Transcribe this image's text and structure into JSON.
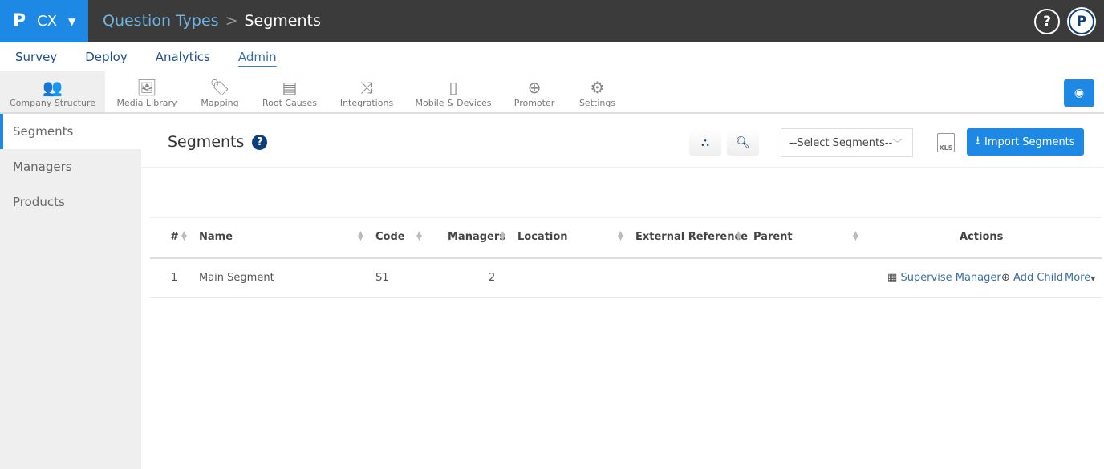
{
  "header": {
    "logo": "P",
    "product": "CX",
    "breadcrumb": [
      "Question Types",
      "Segments"
    ],
    "help_icon": "?",
    "profile_icon": "P"
  },
  "nav": [
    "Survey",
    "Deploy",
    "Analytics",
    "Admin"
  ],
  "tools": [
    {
      "label": "Company Structure",
      "icon": "people-icon"
    },
    {
      "label": "Media Library",
      "icon": "image-icon"
    },
    {
      "label": "Mapping",
      "icon": "tag-icon"
    },
    {
      "label": "Root Causes",
      "icon": "root-causes-icon"
    },
    {
      "label": "Integrations",
      "icon": "shuffle-icon"
    },
    {
      "label": "Mobile & Devices",
      "icon": "mobile-icon"
    },
    {
      "label": "Promoter",
      "icon": "chat-plus-icon"
    },
    {
      "label": "Settings",
      "icon": "gear-icon"
    }
  ],
  "sidebar": [
    "Segments",
    "Managers",
    "Products"
  ],
  "page": {
    "title": "Segments",
    "select_placeholder": "--Select Segments--",
    "xls": "XLS",
    "import": "Import Segments"
  },
  "table": {
    "headers": [
      "#",
      "Name",
      "Code",
      "Managers",
      "Location",
      "External Reference",
      "Parent",
      "Actions"
    ],
    "rows": [
      {
        "num": "1",
        "name": "Main Segment",
        "code": "S1",
        "managers": "2",
        "location": "",
        "external_reference": "",
        "parent": ""
      }
    ],
    "actions": {
      "supervise": "Supervise Manager",
      "add_child": "Add Child",
      "more": "More"
    }
  },
  "colors": {
    "accent": "#1e88e5",
    "topbar": "#3b3b3b"
  }
}
